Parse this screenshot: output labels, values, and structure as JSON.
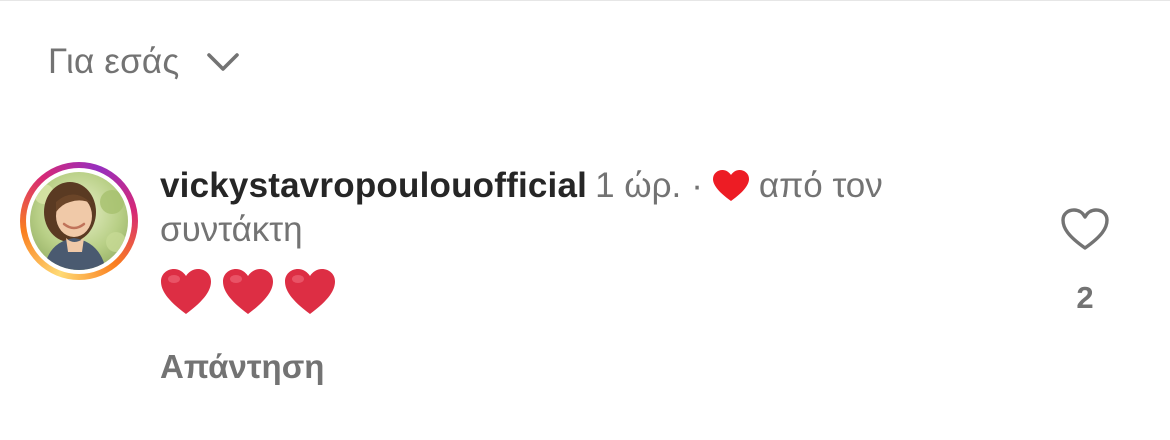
{
  "sort": {
    "label": "Για εσάς",
    "icon": "chevron-down-icon"
  },
  "comment": {
    "username": "vickystavropoulouofficial",
    "time": "1 ώρ.",
    "separator": "·",
    "liked_by_creator_text": "από τον συντάκτη",
    "text_emoji_count": 3,
    "reply_label": "Απάντηση",
    "like_count": "2"
  },
  "colors": {
    "text_primary": "#262626",
    "text_secondary": "#737373",
    "heart_red": "#ed4956"
  }
}
